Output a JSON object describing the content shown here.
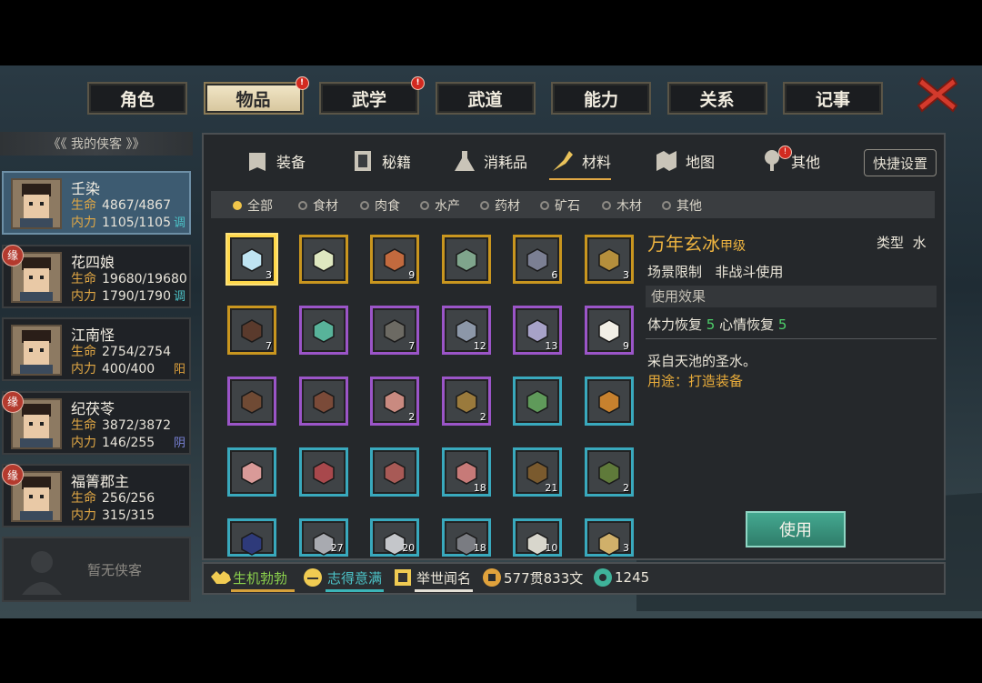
{
  "top_tabs": [
    {
      "label": "角色",
      "active": false,
      "badge": false
    },
    {
      "label": "物品",
      "active": true,
      "badge": true
    },
    {
      "label": "武学",
      "active": false,
      "badge": true
    },
    {
      "label": "武道",
      "active": false,
      "badge": false
    },
    {
      "label": "能力",
      "active": false,
      "badge": false
    },
    {
      "label": "关系",
      "active": false,
      "badge": false
    },
    {
      "label": "记事",
      "active": false,
      "badge": false
    }
  ],
  "sidebar": {
    "title": "《《 我的侠客 》》",
    "heroes": [
      {
        "name": "壬染",
        "life_label": "生命",
        "life": "4867/4867",
        "inner_label": "内力",
        "inner": "1105/1105",
        "tag": "调",
        "tag_color": "#4cc3c8",
        "yuan": false,
        "selected": true
      },
      {
        "name": "花四娘",
        "life_label": "生命",
        "life": "19680/19680",
        "inner_label": "内力",
        "inner": "1790/1790",
        "tag": "调",
        "tag_color": "#4cc3c8",
        "yuan": true,
        "selected": false
      },
      {
        "name": "江南怪",
        "life_label": "生命",
        "life": "2754/2754",
        "inner_label": "内力",
        "inner": "400/400",
        "tag": "阳",
        "tag_color": "#e0a23c",
        "yuan": false,
        "selected": false
      },
      {
        "name": "纪茯苓",
        "life_label": "生命",
        "life": "3872/3872",
        "inner_label": "内力",
        "inner": "146/255",
        "tag": "阴",
        "tag_color": "#7a83d8",
        "yuan": true,
        "selected": false
      },
      {
        "name": "福箐郡主",
        "life_label": "生命",
        "life": "256/256",
        "inner_label": "内力",
        "inner": "315/315",
        "tag": "",
        "tag_color": "#4cc3c8",
        "yuan": true,
        "selected": false
      }
    ],
    "empty_label": "暂无侠客",
    "yuan_label": "缘"
  },
  "subtabs": [
    {
      "label": "装备",
      "icon": "armor-icon"
    },
    {
      "label": "秘籍",
      "icon": "book-icon"
    },
    {
      "label": "消耗品",
      "icon": "flask-icon"
    },
    {
      "label": "材料",
      "icon": "material-icon"
    },
    {
      "label": "地图",
      "icon": "map-icon"
    },
    {
      "label": "其他",
      "icon": "misc-icon"
    }
  ],
  "quick_settings": "快捷设置",
  "filters": [
    "全部",
    "食材",
    "肉食",
    "水产",
    "药材",
    "矿石",
    "木材",
    "其他"
  ],
  "items": [
    {
      "rarity": "gold",
      "count": "3",
      "color": "#bfe4f2",
      "selected": true
    },
    {
      "rarity": "gold",
      "count": "",
      "color": "#dfe8c0"
    },
    {
      "rarity": "gold",
      "count": "9",
      "color": "#c26a3e"
    },
    {
      "rarity": "gold",
      "count": "",
      "color": "#7fa58c"
    },
    {
      "rarity": "gold",
      "count": "6",
      "color": "#7b7f93"
    },
    {
      "rarity": "gold",
      "count": "3",
      "color": "#b58f3c"
    },
    {
      "rarity": "gold",
      "count": "7",
      "color": "#5a3a2c"
    },
    {
      "rarity": "purple",
      "count": "",
      "color": "#58b39a"
    },
    {
      "rarity": "purple",
      "count": "7",
      "color": "#6c6a63"
    },
    {
      "rarity": "purple",
      "count": "12",
      "color": "#8c97a8"
    },
    {
      "rarity": "purple",
      "count": "13",
      "color": "#a7a2c8"
    },
    {
      "rarity": "purple",
      "count": "9",
      "color": "#f2efe6"
    },
    {
      "rarity": "purple",
      "count": "",
      "color": "#6f4a34"
    },
    {
      "rarity": "purple",
      "count": "",
      "color": "#7a4a38"
    },
    {
      "rarity": "purple",
      "count": "2",
      "color": "#c98a80"
    },
    {
      "rarity": "purple",
      "count": "2",
      "color": "#9a7a3c"
    },
    {
      "rarity": "cyan",
      "count": "",
      "color": "#5f9a5a"
    },
    {
      "rarity": "cyan",
      "count": "",
      "color": "#c7812e"
    },
    {
      "rarity": "cyan",
      "count": "",
      "color": "#d99a98"
    },
    {
      "rarity": "cyan",
      "count": "",
      "color": "#a8484c"
    },
    {
      "rarity": "cyan",
      "count": "",
      "color": "#a85a56"
    },
    {
      "rarity": "cyan",
      "count": "18",
      "color": "#c77a78"
    },
    {
      "rarity": "cyan",
      "count": "21",
      "color": "#7a5a2e"
    },
    {
      "rarity": "cyan",
      "count": "2",
      "color": "#5f7a3a"
    },
    {
      "rarity": "cyan",
      "count": "",
      "color": "#2e3a7a"
    },
    {
      "rarity": "cyan",
      "count": "27",
      "color": "#a8aab0"
    },
    {
      "rarity": "cyan",
      "count": "20",
      "color": "#c4c6ca"
    },
    {
      "rarity": "cyan",
      "count": "18",
      "color": "#7a7c82"
    },
    {
      "rarity": "cyan",
      "count": "10",
      "color": "#d8d6cc"
    },
    {
      "rarity": "cyan",
      "count": "3",
      "color": "#d0b06a"
    }
  ],
  "detail": {
    "name": "万年玄冰",
    "grade": "甲级",
    "type_label": "类型",
    "type_value": "水",
    "scene_label": "场景限制",
    "scene_value": "非战斗使用",
    "effect_header": "使用效果",
    "effect_1_label": "体力恢复",
    "effect_1_value": "5",
    "effect_2_label": "心情恢复",
    "effect_2_value": "5",
    "description": "采自天池的圣水。",
    "usage": "用途：打造装备",
    "use_button": "使用"
  },
  "status": {
    "vitality": "生机勃勃",
    "mood": "志得意满",
    "fame": "举世闻名",
    "money": "577贯833文",
    "jade": "1245"
  }
}
